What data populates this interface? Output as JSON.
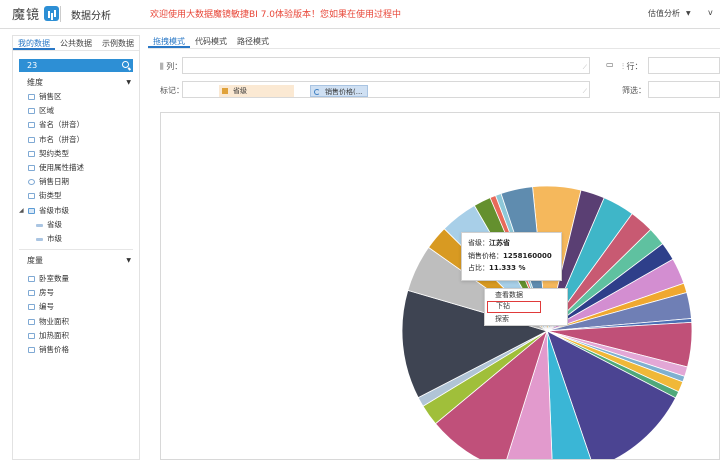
{
  "header": {
    "logo_text": "魔镜",
    "app_name": "数据分析",
    "welcome": "欢迎使用大数据魔镜敏捷BI 7.0体验版本！您如果在使用过程中",
    "menu_right": "估值分析",
    "menu_right_2": "v"
  },
  "sidebar": {
    "tabs": [
      "我的数据",
      "公共数据",
      "示例数据"
    ],
    "search_value": "23",
    "dimension_title": "维度",
    "dimensions": [
      {
        "label": "销售区",
        "icon": "field-icon"
      },
      {
        "label": "区域",
        "icon": "field-icon"
      },
      {
        "label": "省名（拼音）",
        "icon": "field-icon"
      },
      {
        "label": "市名（拼音）",
        "icon": "field-icon"
      },
      {
        "label": "契约类型",
        "icon": "field-icon"
      },
      {
        "label": "使用属性描述",
        "icon": "field-icon"
      },
      {
        "label": "销售日期",
        "icon": "clock-icon"
      },
      {
        "label": "街类型",
        "icon": "field-icon"
      }
    ],
    "group": {
      "label": "省级市级",
      "children": [
        "省级",
        "市级"
      ]
    },
    "measure_title": "度量",
    "measures": [
      "卧室数量",
      "房号",
      "编号",
      "物业面积",
      "加热面积",
      "销售价格"
    ]
  },
  "main": {
    "tabs": [
      "拖拽模式",
      "代码模式",
      "路径模式"
    ],
    "columns_label": "列：",
    "rows_label": "行：",
    "marks_label": "标记：",
    "filter_label": "筛选：",
    "mark_dimension": "省级",
    "mark_measure": "销售价格(..."
  },
  "tooltip": {
    "province_key": "省级：",
    "province_value": "江苏省",
    "price_key": "销售价格：",
    "price_value": "1258160000",
    "pct_key": "占比：",
    "pct_value": "11.333 %"
  },
  "context_menu": [
    "查看数据",
    "下钻",
    "探索"
  ],
  "chart_data": {
    "type": "pie",
    "title": "",
    "slices": [
      {
        "color": "#f5b85c",
        "value": 5.0
      },
      {
        "color": "#5a3f73",
        "value": 2.5
      },
      {
        "color": "#3fb6c8",
        "value": 3.3
      },
      {
        "color": "#c85a72",
        "value": 2.5
      },
      {
        "color": "#5fc1a0",
        "value": 1.9
      },
      {
        "color": "#2e3f8a",
        "value": 1.9
      },
      {
        "color": "#d38ed1",
        "value": 2.7
      },
      {
        "color": "#f0a830",
        "value": 1.0
      },
      {
        "color": "#6f7fb5",
        "value": 2.7
      },
      {
        "color": "#4a6fb5",
        "value": 0.4
      },
      {
        "color": "#c05078",
        "value": 4.6
      },
      {
        "color": "#e3a7d6",
        "value": 1.0
      },
      {
        "color": "#7fb0d0",
        "value": 0.6
      },
      {
        "color": "#f0b838",
        "value": 1.1
      },
      {
        "color": "#4fa87a",
        "value": 0.7
      },
      {
        "color": "#4b4492",
        "value": 11.3
      },
      {
        "color": "#3ab6d6",
        "value": 4.3
      },
      {
        "color": "#e29acd",
        "value": 5.1
      },
      {
        "color": "#c0507a",
        "value": 8.5
      },
      {
        "color": "#a0bf3a",
        "value": 2.2
      },
      {
        "color": "#b0c4d6",
        "value": 1.0
      },
      {
        "color": "#3e4452",
        "value": 11.3
      },
      {
        "color": "#bebebe",
        "value": 4.9
      },
      {
        "color": "#d89a22",
        "value": 2.5
      },
      {
        "color": "#a8cfe8",
        "value": 3.9
      },
      {
        "color": "#64902e",
        "value": 1.8
      },
      {
        "color": "#e86a5a",
        "value": 0.6
      },
      {
        "color": "#8ec8d8",
        "value": 0.6
      },
      {
        "color": "#5f8caf",
        "value": 3.3
      }
    ]
  }
}
